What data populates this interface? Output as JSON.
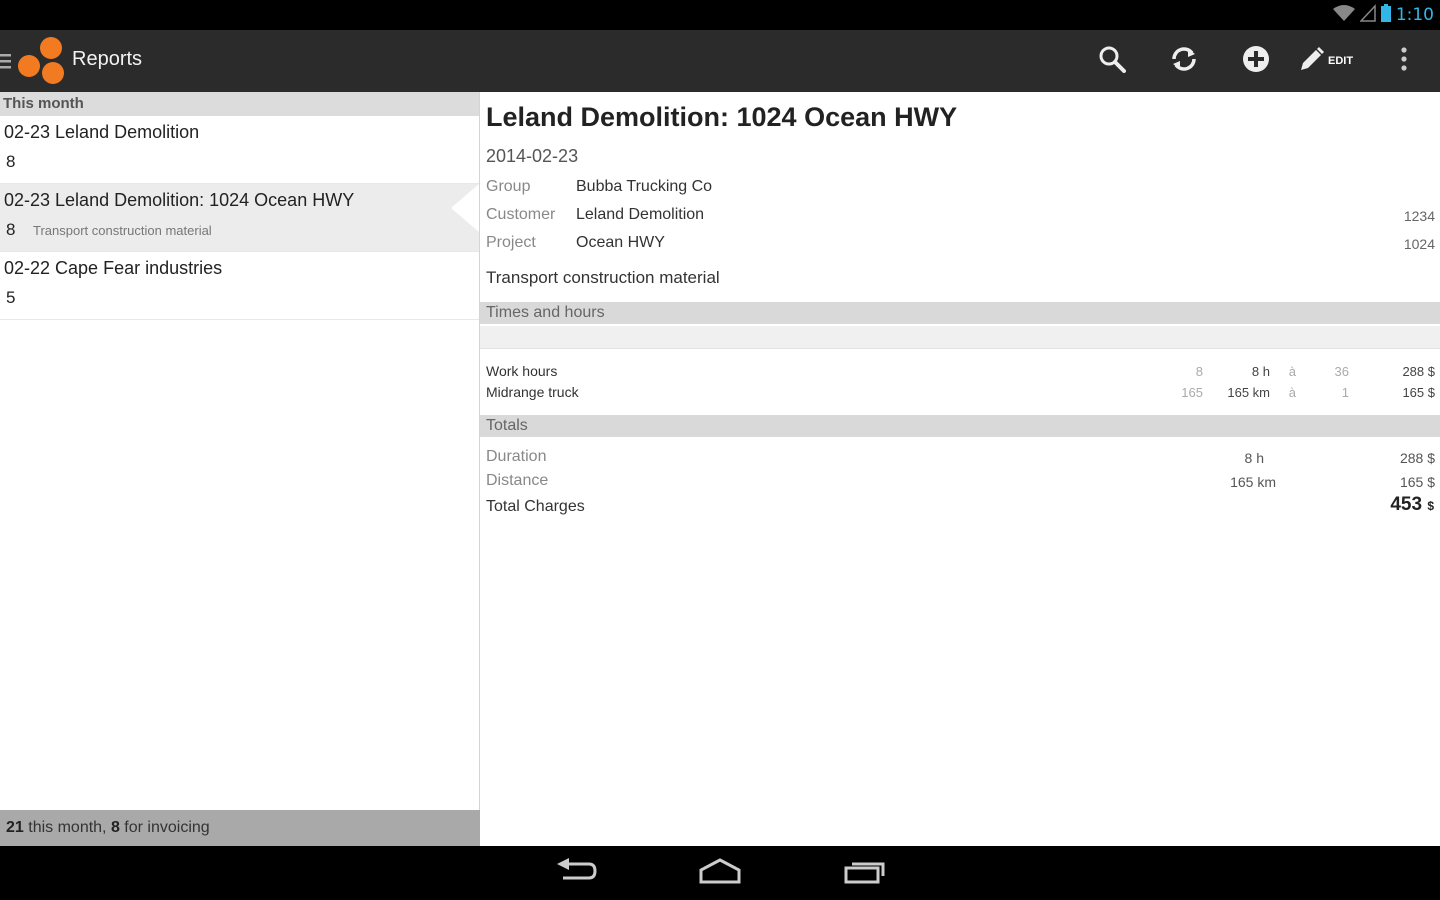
{
  "status": {
    "time": "1:10",
    "icons": [
      "wifi-icon",
      "signal-icon",
      "battery-icon"
    ]
  },
  "actionbar": {
    "title": "Reports",
    "actions": [
      "search-icon",
      "sync-icon",
      "add-icon",
      "edit-icon",
      "overflow-menu-icon"
    ],
    "edit_label": "EDIT"
  },
  "list": {
    "section": "This month",
    "items": [
      {
        "title": "02-23 Leland Demolition",
        "count": "8",
        "sub": ""
      },
      {
        "title": "02-23 Leland Demolition: 1024 Ocean HWY",
        "count": "8",
        "sub": "Transport construction material"
      },
      {
        "title": "02-22 Cape Fear industries",
        "count": "5",
        "sub": ""
      }
    ],
    "footer": {
      "month_count": "21",
      "month_text": " this month, ",
      "invoice_count": "8",
      "invoice_text": " for invoicing"
    }
  },
  "detail": {
    "title": "Leland Demolition: 1024 Ocean HWY",
    "date": "2014-02-23",
    "fields": [
      {
        "label": "Group",
        "value": "Bubba Trucking Co",
        "code": ""
      },
      {
        "label": "Customer",
        "value": "Leland Demolition",
        "code": "1234"
      },
      {
        "label": "Project",
        "value": "Ocean HWY",
        "code": "1024"
      }
    ],
    "description": "Transport construction material",
    "times_header": "Times and hours",
    "lines": [
      {
        "label": "Work hours",
        "qty": "8",
        "amount": "8 h",
        "at": "à",
        "rate": "36",
        "total": "288 $"
      },
      {
        "label": "Midrange truck",
        "qty": "165",
        "amount": "165 km",
        "at": "à",
        "rate": "1",
        "total": "165 $"
      }
    ],
    "totals_header": "Totals",
    "totals": [
      {
        "label": "Duration",
        "amount": "8 h",
        "total": "288 $"
      },
      {
        "label": "Distance",
        "amount": "165 km",
        "total": "165 $"
      }
    ],
    "total_charges": {
      "label": "Total Charges",
      "value": "453",
      "unit": "$"
    }
  },
  "navbar": [
    "back-icon",
    "home-icon",
    "recent-apps-icon"
  ],
  "colors": {
    "accent": "#f27b22",
    "status": "#33b5e5",
    "actionbar": "#2b2b2b"
  }
}
